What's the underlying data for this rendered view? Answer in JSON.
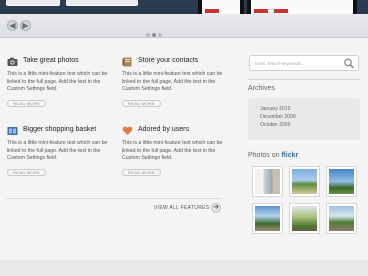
{
  "slider": {
    "prev_glyph": "◀",
    "next_glyph": "▶",
    "dots": 3,
    "active_dot": 2
  },
  "features": [
    {
      "icon": "camera-icon",
      "title": "Take great photos",
      "text": "This is a little mini-feature text which can be linked to the full page. Add the text in the Custom Settings field.",
      "more": "READ MORE"
    },
    {
      "icon": "address-book-icon",
      "title": "Store your contacts",
      "text": "This is a little mini-feature text which can be linked to the full page. Add the text in the Custom Settings field.",
      "more": "READ MORE"
    },
    {
      "icon": "shopping-basket-icon",
      "title": "Bigger shopping basket",
      "text": "This is a little mini-feature text which can be linked to the full page. Add the text in the Custom Settings field.",
      "more": "READ MORE"
    },
    {
      "icon": "heart-icon",
      "title": "Adored by users",
      "text": "This is a little mini-feature text which can be linked to the full page. Add the text in the Custom Settings field.",
      "more": "READ MORE"
    }
  ],
  "view_all": {
    "label": "VIEW ALL FEATURES",
    "glyph": "➔"
  },
  "sidebar": {
    "search_placeholder": "Enter search keywords...",
    "archives": {
      "title": "Archives",
      "items": [
        "January 2010",
        "December 2009",
        "October 2009"
      ]
    },
    "flickr": {
      "title_prefix": "Photos on ",
      "brand": "flickr"
    }
  },
  "colors": {
    "accent": "#2a6fb8",
    "banner": "#2d3e55",
    "heart": "#e07a4a"
  }
}
